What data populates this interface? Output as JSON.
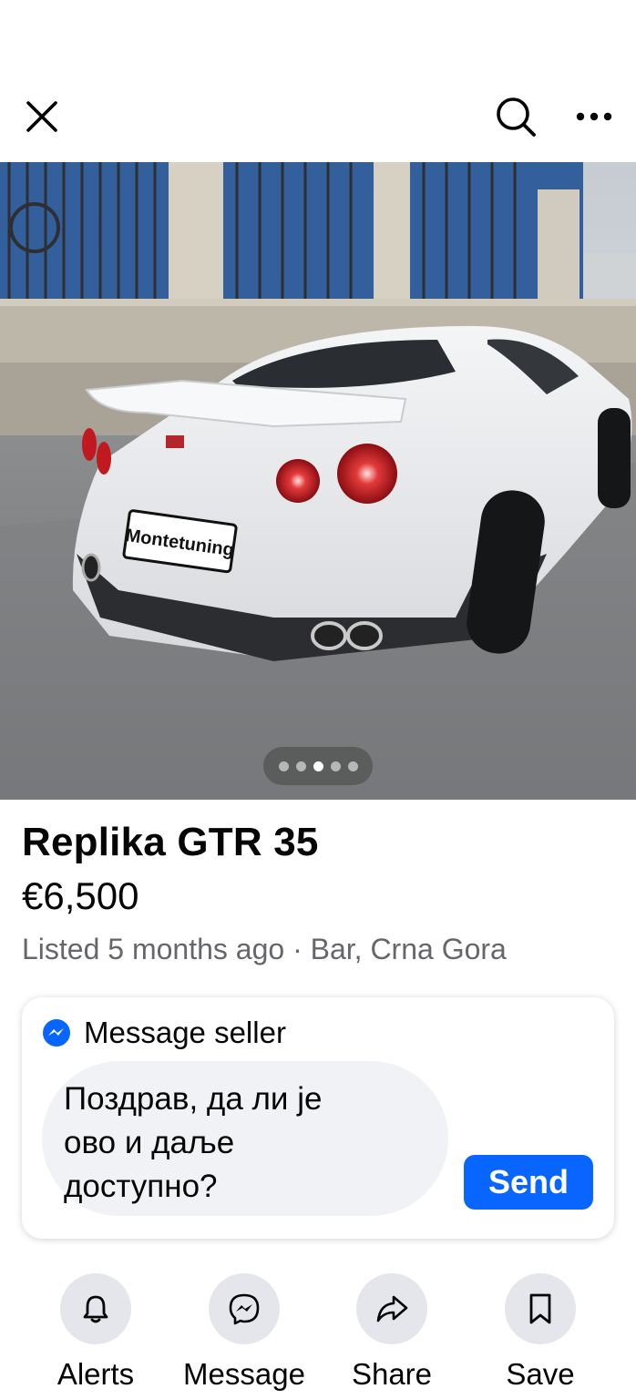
{
  "header": {
    "close_icon": "close-icon",
    "search_icon": "search-icon",
    "more_icon": "more-icon"
  },
  "photo": {
    "plate_text": "Montetuning",
    "carousel_total": 5,
    "carousel_active_index": 3
  },
  "listing": {
    "title": "Replika GTR 35",
    "price": "€6,500",
    "meta": "Listed 5 months ago · Bar, Crna Gora"
  },
  "message_card": {
    "heading": "Message seller",
    "message_text": "Поздрав, да ли је ово и даље доступно?",
    "send_label": "Send",
    "accent_color": "#0866ff"
  },
  "actions": [
    {
      "label": "Alerts",
      "icon": "bell-icon"
    },
    {
      "label": "Message",
      "icon": "messenger-icon"
    },
    {
      "label": "Share",
      "icon": "share-icon"
    },
    {
      "label": "Save",
      "icon": "bookmark-icon"
    }
  ]
}
